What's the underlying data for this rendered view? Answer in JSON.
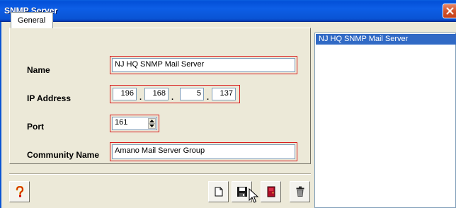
{
  "window": {
    "title": "SNMP Server"
  },
  "tabs": [
    {
      "label": "General"
    }
  ],
  "form": {
    "name": {
      "label": "Name",
      "value": "NJ HQ SNMP Mail Server"
    },
    "ip_address": {
      "label": "IP Address",
      "octets": [
        "196",
        "168",
        "5",
        "137"
      ]
    },
    "port": {
      "label": "Port",
      "value": "161"
    },
    "community_name": {
      "label": "Community Name",
      "value": "Amano Mail Server Group"
    }
  },
  "toolbar": {
    "help_icon": "help-icon",
    "new_icon": "new-document-icon",
    "save_icon": "save-disk-icon",
    "exit_icon": "exit-door-icon",
    "delete_icon": "trash-icon"
  },
  "server_list": {
    "items": [
      "NJ HQ SNMP Mail Server"
    ]
  },
  "colors": {
    "title_bar": "#0a54d4",
    "highlight_frame": "#d81c1c",
    "selection": "#316ac5",
    "dialog_bg": "#ece9d8"
  }
}
